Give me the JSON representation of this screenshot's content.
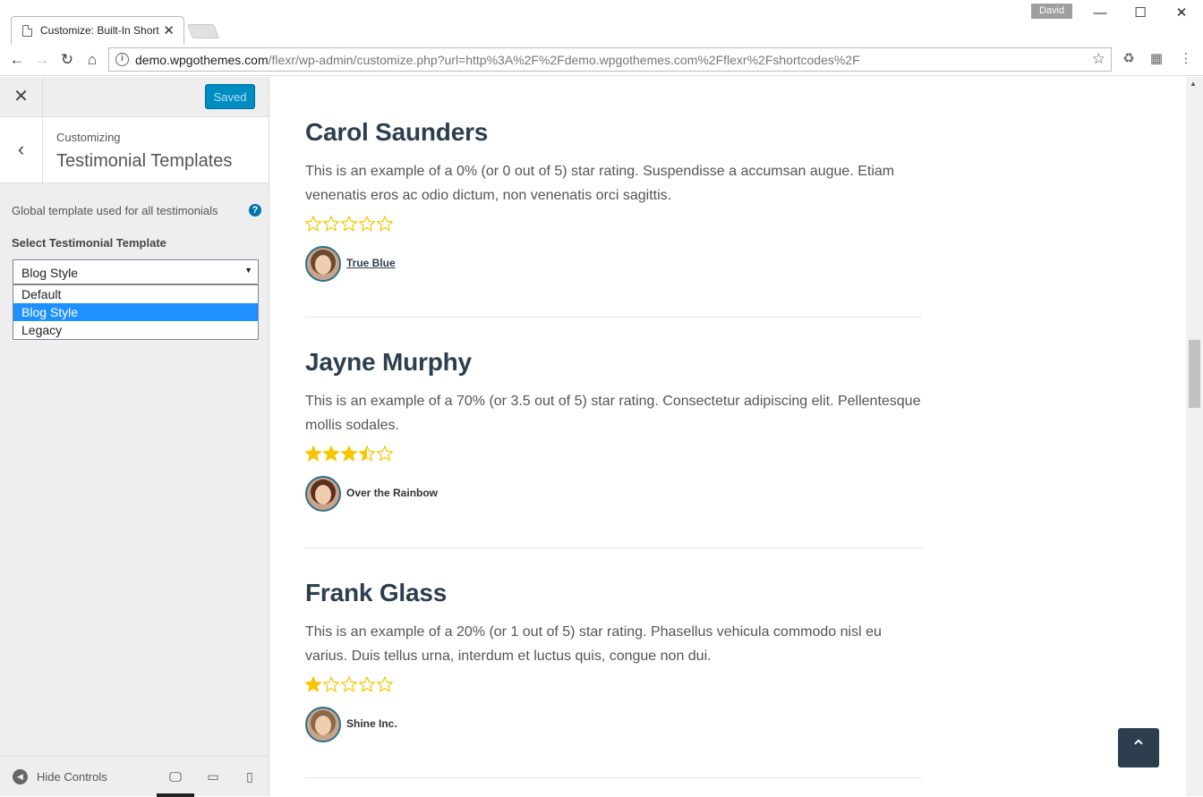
{
  "browser": {
    "tab_title": "Customize: Built-In Short",
    "user": "David",
    "url_host": "demo.wpgothemes.com",
    "url_path": "/flexr/wp-admin/customize.php?url=http%3A%2F%2Fdemo.wpgothemes.com%2Fflexr%2Fshortcodes%2F"
  },
  "customizer": {
    "saved_label": "Saved",
    "customizing_label": "Customizing",
    "section_title": "Testimonial Templates",
    "description": "Global template used for all testimonials",
    "select_label": "Select Testimonial Template",
    "selected_value": "Blog Style",
    "options": [
      "Default",
      "Blog Style",
      "Legacy"
    ],
    "hide_controls_label": "Hide Controls"
  },
  "testimonials": [
    {
      "name": "Carol Saunders",
      "body": "This is an example of a 0% (or 0 out of 5) star rating. Suspendisse a accumsan augue. Etiam venenatis eros ac odio dictum, non venenatis orci sagittis.",
      "rating": 0,
      "company": "True Blue"
    },
    {
      "name": "Jayne Murphy",
      "body": "This is an example of a 70% (or 3.5 out of 5) star rating. Consectetur adipiscing elit. Pellentesque mollis sodales.",
      "rating": 3.5,
      "company": "Over the Rainbow"
    },
    {
      "name": "Frank Glass",
      "body": "This is an example of a 20% (or 1 out of 5) star rating. Phasellus vehicula commodo nisl eu varius. Duis tellus urna, interdum et luctus quis, congue non dui.",
      "rating": 1,
      "company": "Shine Inc."
    }
  ],
  "colors": {
    "star": "#f7c600",
    "accent": "#008ec2",
    "heading": "#2d3e4e"
  }
}
